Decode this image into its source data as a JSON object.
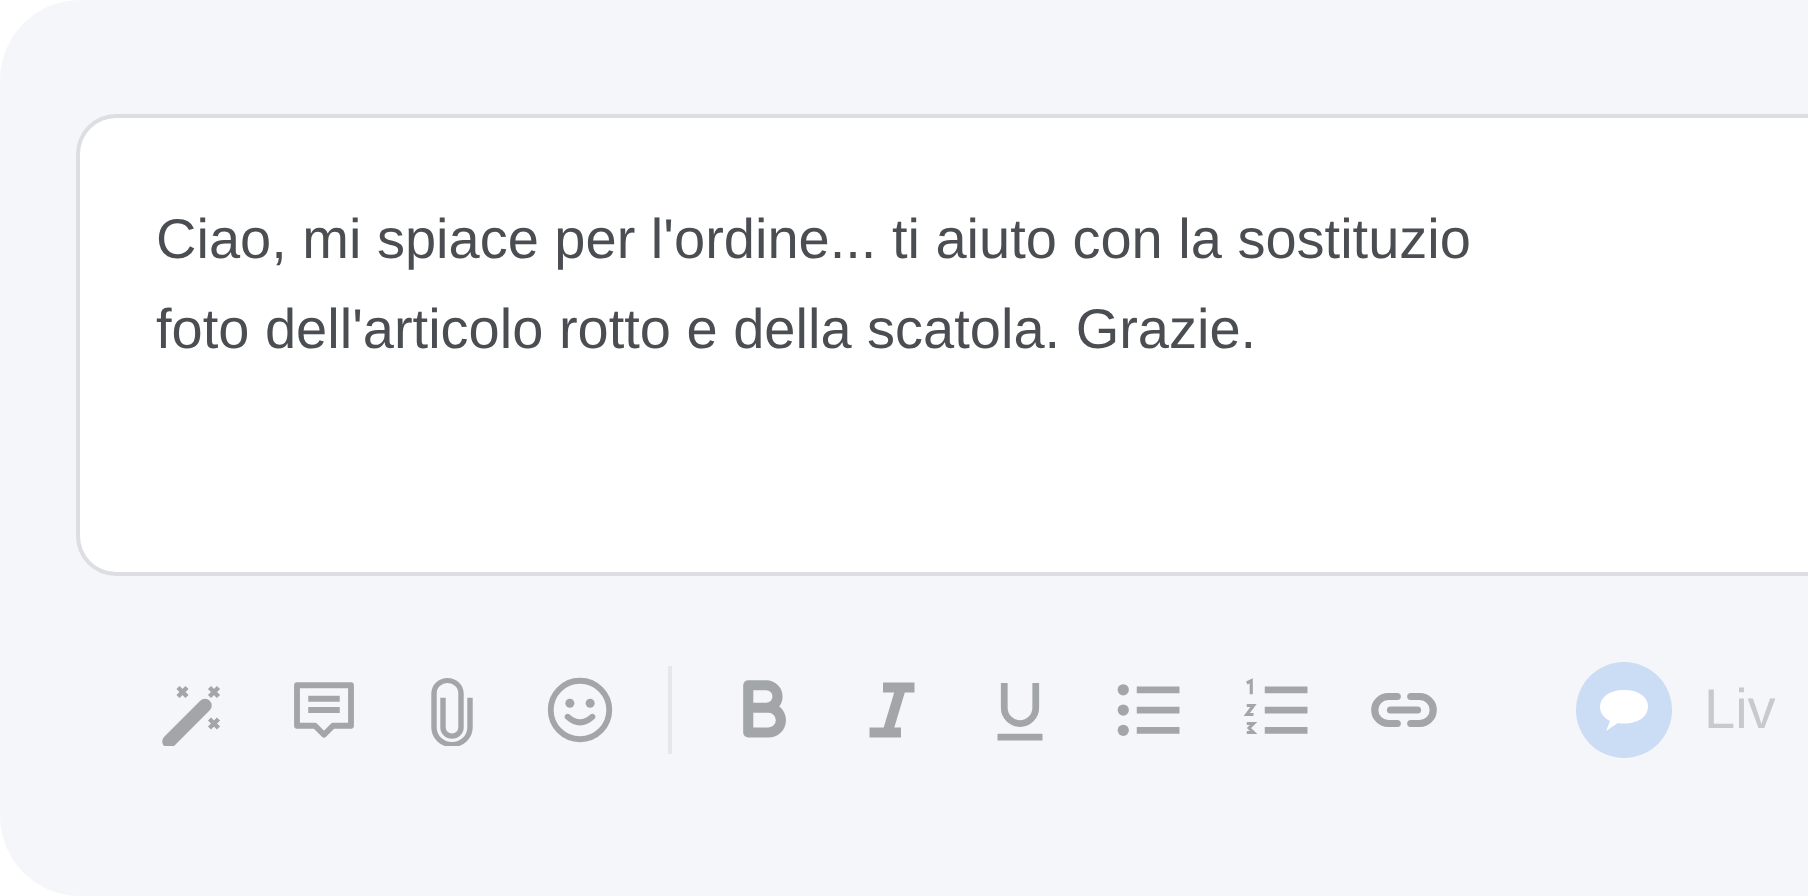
{
  "editor": {
    "lines": [
      "Ciao, mi spiace per l'ordine... ti aiuto con la sostituzio",
      "foto dell'articolo rotto e della scatola. Grazie."
    ]
  },
  "toolbar": {
    "tools": [
      {
        "kind": "wand"
      },
      {
        "kind": "comment"
      },
      {
        "kind": "attach"
      },
      {
        "kind": "emoji"
      },
      {
        "kind": "divider"
      },
      {
        "kind": "bold"
      },
      {
        "kind": "italic"
      },
      {
        "kind": "underline"
      },
      {
        "kind": "bullets"
      },
      {
        "kind": "numbers"
      },
      {
        "kind": "link"
      }
    ],
    "live": {
      "label": "Liv",
      "disabled": true
    }
  }
}
